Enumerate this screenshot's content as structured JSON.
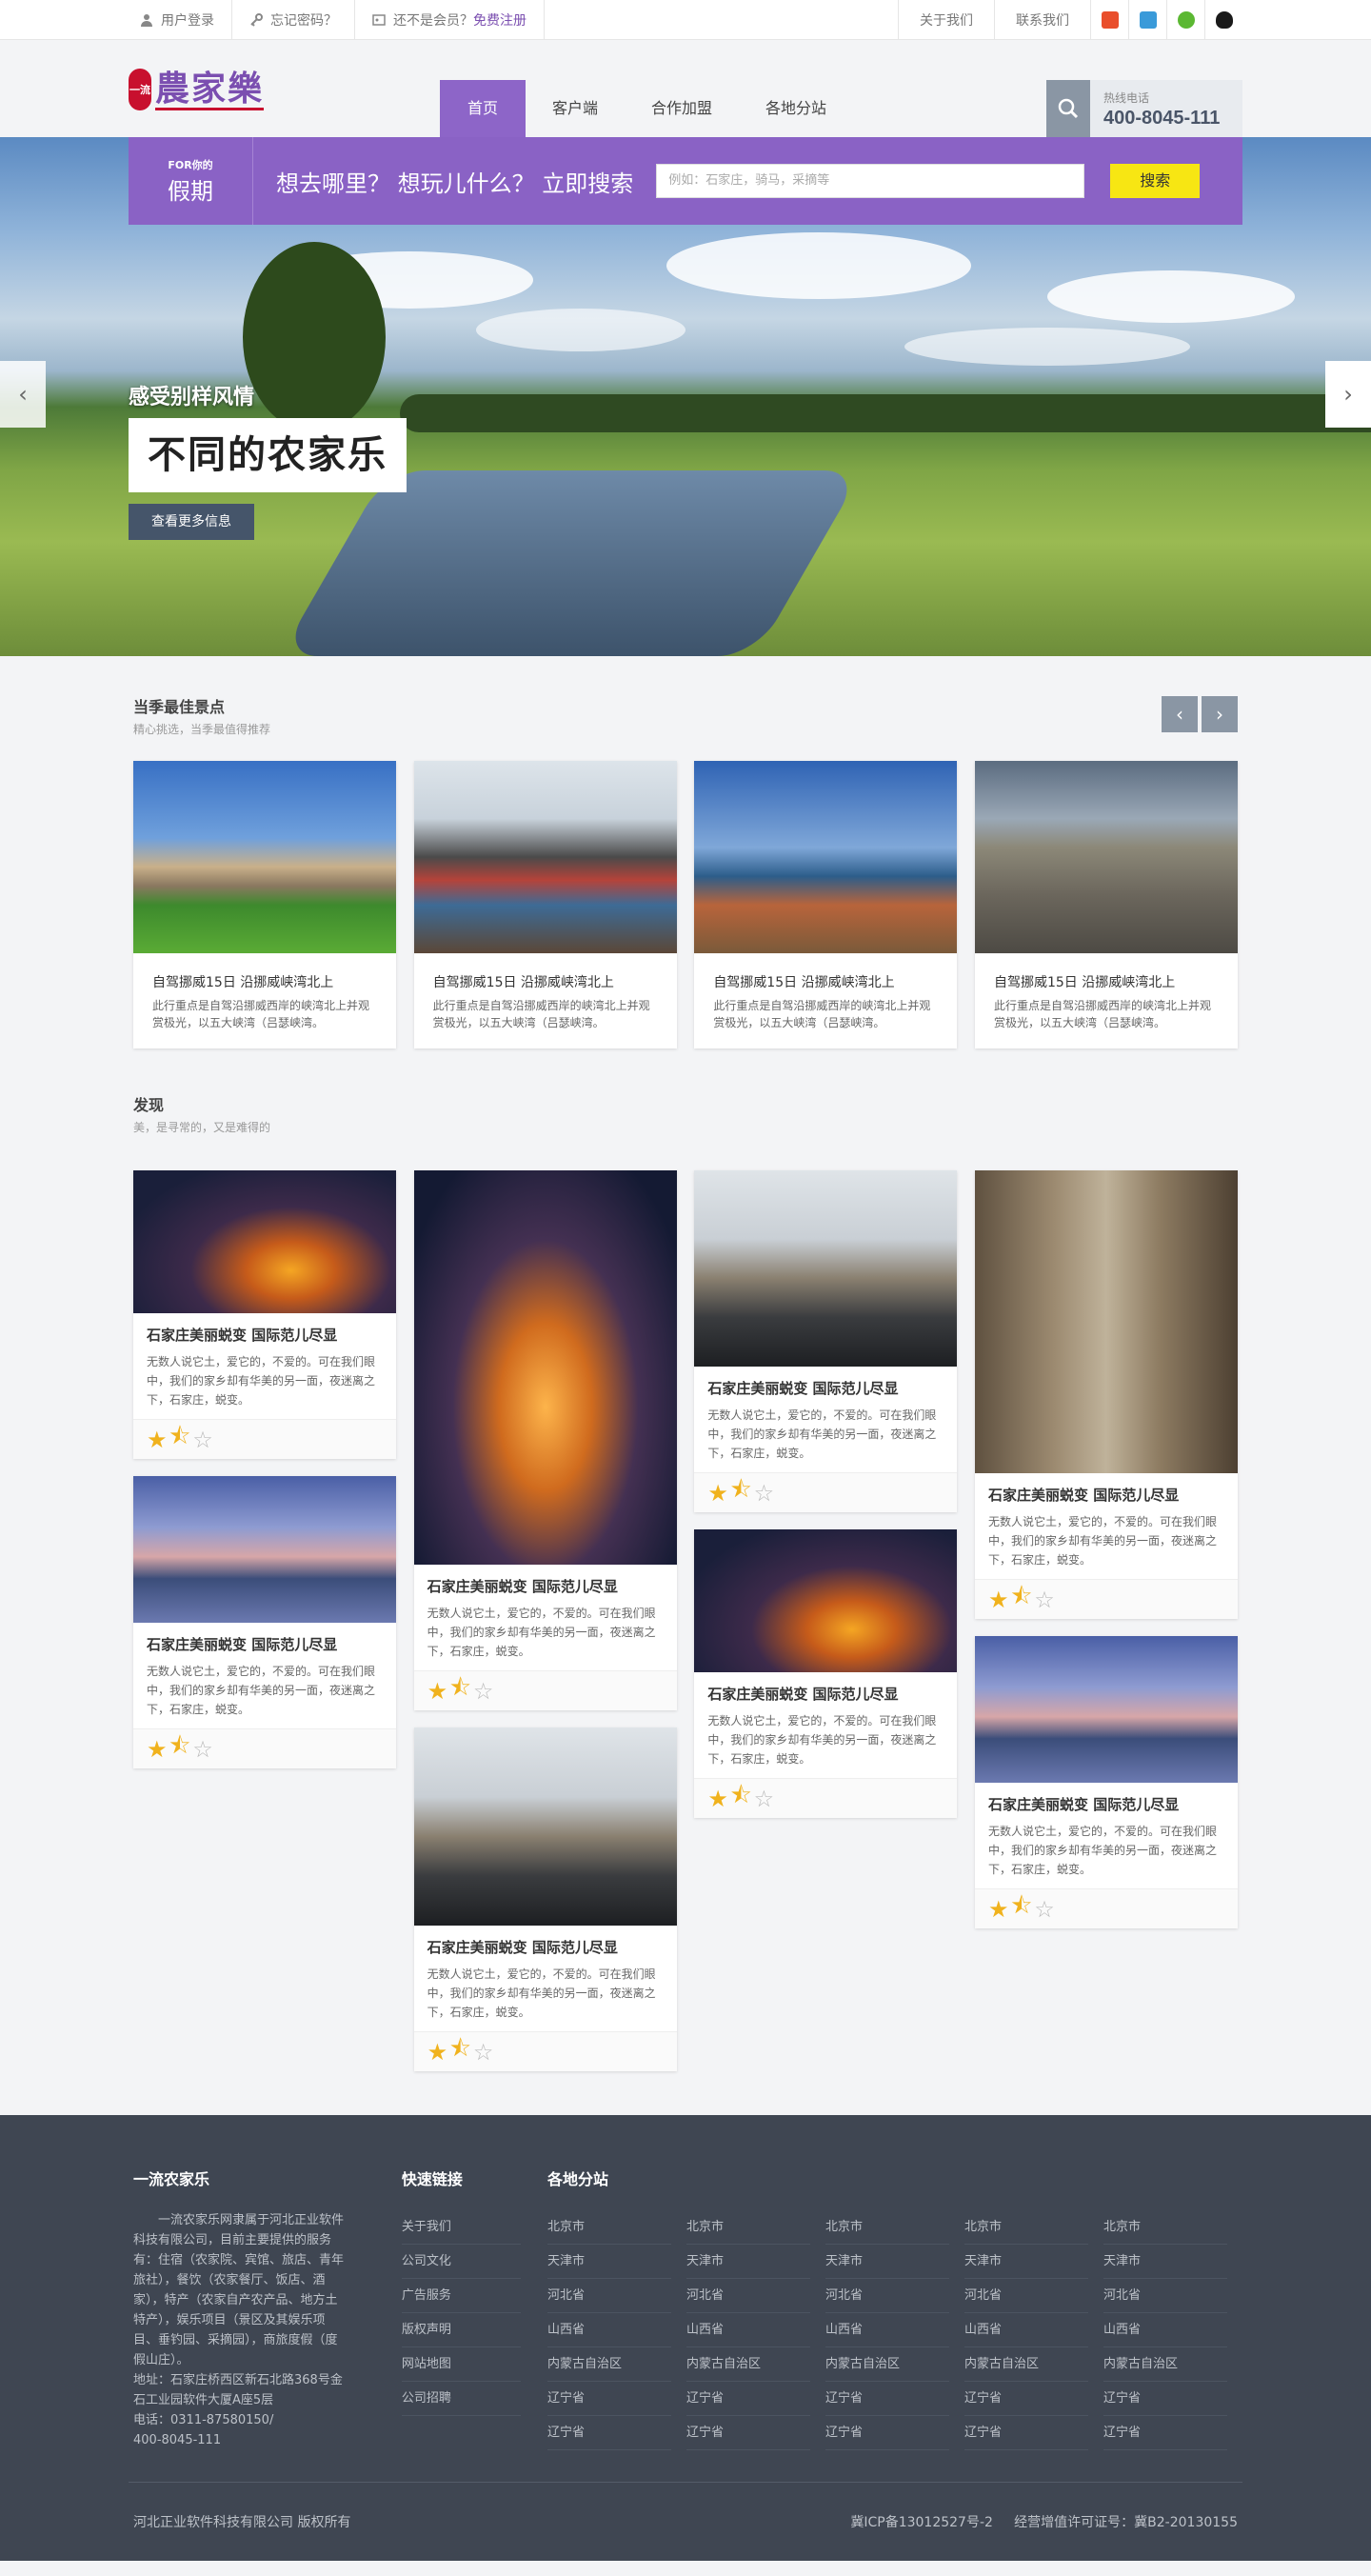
{
  "topbar": {
    "login": "用户登录",
    "forgot": "忘记密码？",
    "member_q": "还不是会员？",
    "register": "免费注册",
    "about": "关于我们",
    "contact": "联系我们",
    "social_icons": [
      "rss-icon",
      "sina-icon",
      "wechat-icon",
      "qq-icon"
    ]
  },
  "header": {
    "logo_text": "農家樂",
    "logo_seal": "一流",
    "nav": [
      "首页",
      "客户端",
      "合作加盟",
      "各地分站"
    ],
    "hotline_label": "热线电话",
    "hotline_number": "400-8045-111"
  },
  "search": {
    "tag_small": "FOR你的",
    "tag_big": "假期",
    "question": "想去哪里？ 想玩儿什么？  立即搜索",
    "placeholder": "例如：石家庄，骑马，采摘等",
    "button": "搜索"
  },
  "banner": {
    "line1": "感受别样风情",
    "line2": "不同的农家乐",
    "more": "查看更多信息"
  },
  "best": {
    "title": "当季最佳景点",
    "subtitle": "精心挑选，当季最值得推荐",
    "cards": [
      {
        "title": "自驾挪威15日 沿挪威峡湾北上",
        "desc": "此行重点是自驾沿挪威西岸的峡湾北上并观赏极光，以五大峡湾（吕瑟峡湾。"
      },
      {
        "title": "自驾挪威15日 沿挪威峡湾北上",
        "desc": "此行重点是自驾沿挪威西岸的峡湾北上并观赏极光，以五大峡湾（吕瑟峡湾。"
      },
      {
        "title": "自驾挪威15日 沿挪威峡湾北上",
        "desc": "此行重点是自驾沿挪威西岸的峡湾北上并观赏极光，以五大峡湾（吕瑟峡湾。"
      },
      {
        "title": "自驾挪威15日 沿挪威峡湾北上",
        "desc": "此行重点是自驾沿挪威西岸的峡湾北上并观赏极光，以五大峡湾（吕瑟峡湾。"
      }
    ]
  },
  "discover": {
    "title": "发现",
    "subtitle": "美，是寻常的，又是难得的",
    "item_title": "石家庄美丽蜕变  国际范儿尽显",
    "item_desc": "无数人说它土，爱它的，不爱的。可在我们眼中，我们的家乡却有华美的另一面，夜迷离之下，石家庄，蜕变。",
    "rating": 1.5
  },
  "footer": {
    "about_title": "一流农家乐",
    "about_text": "一流农家乐网隶属于河北正业软件科技有限公司，目前主要提供的服务有：住宿（农家院、宾馆、旅店、青年旅社），餐饮（农家餐厅、饭店、酒家），特产（农家自产农产品、地方土特产），娱乐项目（景区及其娱乐项目、垂钓园、采摘园），商旅度假（度假山庄）。",
    "address": "地址：石家庄桥西区新石北路368号金石工业园软件大厦A座5层",
    "phone": "电话：0311-87580150/",
    "phone2": "400-8045-111",
    "links_title": "快速链接",
    "links": [
      "关于我们",
      "公司文化",
      "广告服务",
      "版权声明",
      "网站地图",
      "公司招聘"
    ],
    "branch_title": "各地分站",
    "branches": [
      "北京市",
      "天津市",
      "河北省",
      "山西省",
      "内蒙古自治区",
      "辽宁省",
      "辽宁省"
    ],
    "copyright": "河北正业软件科技有限公司 版权所有",
    "icp": "冀ICP备13012527号-2     经营增值许可证号：冀B2-20130155"
  }
}
